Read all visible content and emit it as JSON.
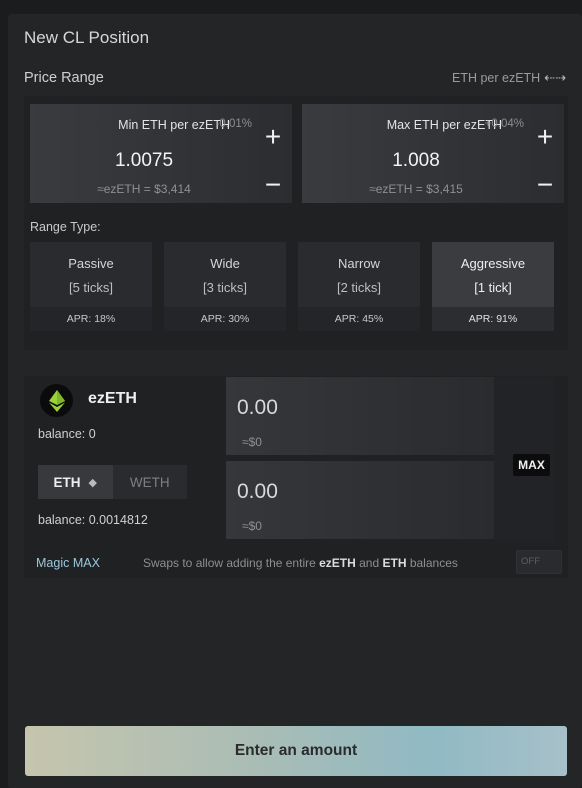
{
  "panel": {
    "title": "New CL Position",
    "price_range_label": "Price Range",
    "unit_label": "ETH per ezETH",
    "unit_swap_icon": "swap-arrows-icon"
  },
  "min_price": {
    "label": "Min ETH per ezETH",
    "pct": "-0.01%",
    "value": "1.0075",
    "usd": "≈ezETH = $3,414",
    "plus": "+",
    "minus": "−"
  },
  "max_price": {
    "label": "Max ETH per ezETH",
    "pct": "+0.04%",
    "value": "1.008",
    "usd": "≈ezETH = $3,415",
    "plus": "+",
    "minus": "−"
  },
  "range_type": {
    "label": "Range Type:",
    "selected": "Aggressive",
    "options": [
      {
        "name": "Passive",
        "ticks": "[5 ticks]",
        "apr": "APR: 18%"
      },
      {
        "name": "Wide",
        "ticks": "[3 ticks]",
        "apr": "APR: 30%"
      },
      {
        "name": "Narrow",
        "ticks": "[2 ticks]",
        "apr": "APR: 45%"
      },
      {
        "name": "Aggressive",
        "ticks": "[1 tick]",
        "apr": "APR: 91%"
      }
    ]
  },
  "deposit": {
    "token1": {
      "name": "ezETH",
      "icon": "ezeth-token-icon",
      "balance": "balance: 0",
      "amount": "0.00",
      "usd": "≈$0"
    },
    "token2": {
      "options": [
        "ETH",
        "WETH"
      ],
      "selected": "ETH",
      "balance": "balance: 0.0014812",
      "amount": "0.00",
      "usd": "≈$0"
    },
    "max_label": "MAX",
    "magic": {
      "label": "Magic MAX",
      "desc_pre": "Swaps to allow adding the entire ",
      "desc_token1": "ezETH",
      "desc_mid": " and ",
      "desc_token2": "ETH",
      "desc_post": " balances",
      "toggle": "OFF"
    }
  },
  "submit": {
    "label": "Enter an amount"
  },
  "colors": {
    "background": "#1b1c1e",
    "panel": "#242527",
    "magic_accent": "#9bc7dc",
    "button_gradient_start": "#c6c5ad",
    "button_gradient_end": "#90bac4"
  }
}
